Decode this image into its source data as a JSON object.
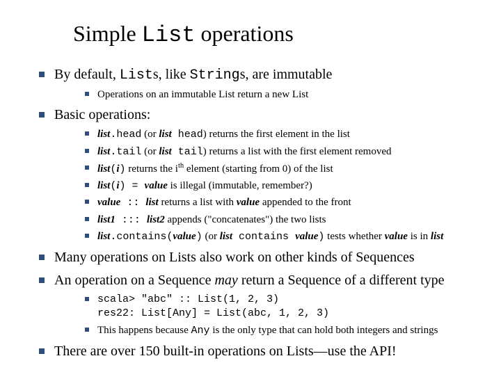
{
  "title_pre": "Simple ",
  "title_code": "List",
  "title_post": " operations",
  "b1_pre": "By default, ",
  "b1_c1": "List",
  "b1_mid": "s, like ",
  "b1_c2": "String",
  "b1_post": "s, are immutable",
  "b1_1": "Operations on an immutable List return a new List",
  "b2": "Basic operations:",
  "b2_1_a": "list",
  "b2_1_b": ".head",
  "b2_1_c": " (or ",
  "b2_1_d": "list",
  "b2_1_e": " head",
  "b2_1_f": ") returns the first element in the list",
  "b2_2_a": "list",
  "b2_2_b": ".tail",
  "b2_2_c": " (or ",
  "b2_2_d": "list",
  "b2_2_e": " tail",
  "b2_2_f": ") returns a list with the first element removed",
  "b2_3_a": "list",
  "b2_3_b": "(",
  "b2_3_c": "i",
  "b2_3_d": ")",
  "b2_3_e": " returns the i",
  "b2_3_sup": "th",
  "b2_3_f": " element (starting from 0) of the list",
  "b2_4_a": "list",
  "b2_4_b": "(",
  "b2_4_c": "i",
  "b2_4_d": ") = ",
  "b2_4_e": "value",
  "b2_4_f": " is illegal (immutable, remember?)",
  "b2_5_a": "value",
  "b2_5_b": " :: ",
  "b2_5_c": "list",
  "b2_5_d": " returns a list with ",
  "b2_5_e": "value",
  "b2_5_f": " appended to the front",
  "b2_6_a": "list1",
  "b2_6_b": " ::: ",
  "b2_6_c": "list2",
  "b2_6_d": " appends (\"concatenates\") the two lists",
  "b2_7_a": "list",
  "b2_7_b": ".contains(",
  "b2_7_c": "value",
  "b2_7_d": ")",
  "b2_7_e": " (or ",
  "b2_7_f": "list",
  "b2_7_g": " contains ",
  "b2_7_h": "value",
  "b2_7_i": ")",
  "b2_7_j": " tests whether ",
  "b2_7_k": "value",
  "b2_7_l": " is in ",
  "b2_7_m": "list",
  "b3": "Many operations on Lists also work on other kinds of Sequences",
  "b4_a": "An operation on a Sequence ",
  "b4_b": "may",
  "b4_c": " return a Sequence of a different type",
  "b4_code": "scala> \"abc\" :: List(1, 2, 3)\nres22: List[Any] = List(abc, 1, 2, 3)",
  "b4_2_a": "This happens because ",
  "b4_2_b": "Any",
  "b4_2_c": " is the only type that can hold both integers and strings",
  "b5": "There are over 150 built-in operations on Lists—use the API!"
}
